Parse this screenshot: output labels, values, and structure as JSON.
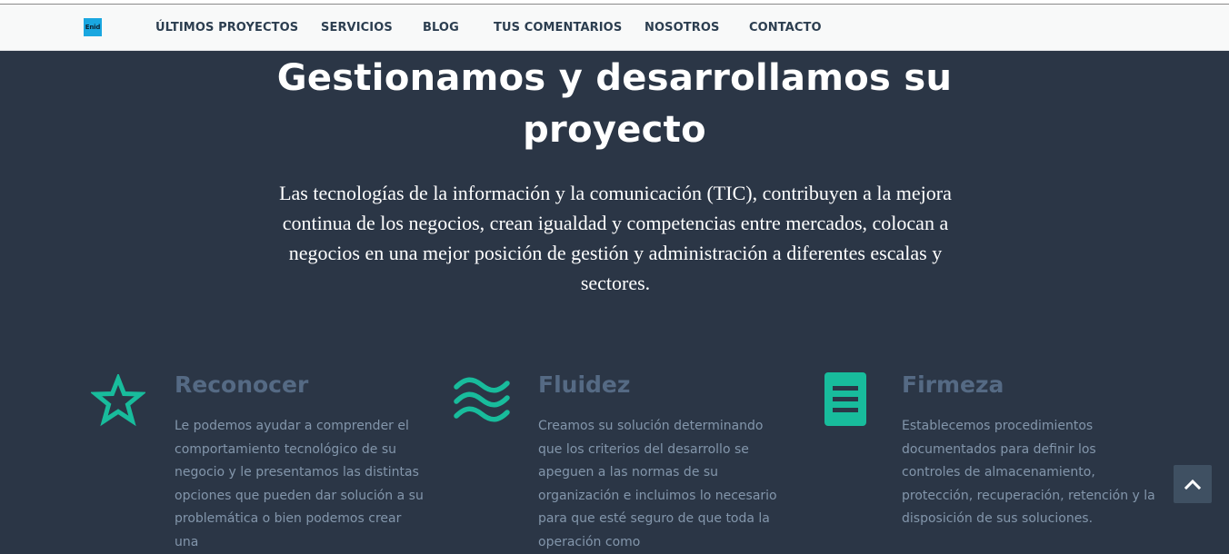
{
  "logo": {
    "text": "Enid"
  },
  "nav": [
    {
      "label": "ÚLTIMOS PROYECTOS"
    },
    {
      "label": "SERVICIOS"
    },
    {
      "label": "BLOG"
    },
    {
      "label": "TUS COMENTARIOS"
    },
    {
      "label": "NOSOTROS"
    },
    {
      "label": "CONTACTO"
    }
  ],
  "hero": {
    "title": "Gestionamos y desarrollamos su proyecto",
    "text": "Las tecnologías de la información y la comunicación (TIC), contribuyen a la mejora continua de los negocios, crean igualdad y competencias entre mercados, colocan a negocios en una mejor posición de gestión y administración a diferentes escalas y sectores."
  },
  "features": [
    {
      "icon": "star-icon",
      "title": "Reconocer",
      "text": "Le podemos ayudar a comprender el comportamiento tecnológico de su negocio y le presentamos las distintas opciones que pueden dar solución a su problemática o bien podemos crear una"
    },
    {
      "icon": "waves-icon",
      "title": "Fluidez",
      "text": "Creamos su solución determinando que los criterios del desarrollo se apeguen a las normas de su organización e incluimos lo necesario para que esté seguro de que toda la operación como"
    },
    {
      "icon": "document-icon",
      "title": "Firmeza",
      "text": "Establecemos procedimientos documentados para definir los controles de almacenamiento, protección, recuperación, retención y la disposición de sus soluciones."
    }
  ],
  "scroll_top": {
    "icon": "chevron-up-icon"
  },
  "colors": {
    "background": "#2b3646",
    "navbar": "#f8f9f9",
    "nav_text": "#2c3e50",
    "accent": "#18bc9c",
    "feature_title": "#556a84",
    "feature_text": "#8396ab",
    "logo": "#1aa7e0"
  }
}
